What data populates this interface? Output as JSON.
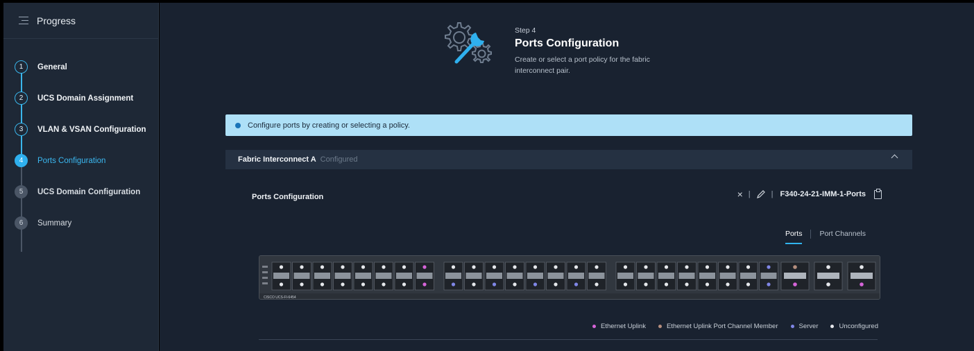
{
  "sidebar": {
    "title": "Progress",
    "steps": [
      {
        "num": "1",
        "label": "General"
      },
      {
        "num": "2",
        "label": "UCS Domain Assignment"
      },
      {
        "num": "3",
        "label": "VLAN & VSAN Configuration"
      },
      {
        "num": "4",
        "label": "Ports Configuration"
      },
      {
        "num": "5",
        "label": "UCS Domain Configuration"
      },
      {
        "num": "6",
        "label": "Summary"
      }
    ]
  },
  "header": {
    "step": "Step 4",
    "title": "Ports Configuration",
    "description": "Create or select a port policy for the fabric interconnect pair."
  },
  "info": {
    "text": "Configure ports by creating or selecting a policy."
  },
  "fabric": {
    "name": "Fabric Interconnect A",
    "status": "Configured"
  },
  "ports_config": {
    "title": "Ports Configuration",
    "clear_icon": "×",
    "divider": "|",
    "policy_name": "F340-24-21-IMM-1-Ports"
  },
  "tabs": {
    "ports": "Ports",
    "port_channels": "Port Channels"
  },
  "switch": {
    "model": "CISCO UCS-FI-6454"
  },
  "legend": [
    {
      "label": "Ethernet Uplink",
      "color": "#d664d8"
    },
    {
      "label": "Ethernet Uplink Port Channel Member",
      "color": "#b58e7e"
    },
    {
      "label": "Server",
      "color": "#7f86e6"
    },
    {
      "label": "Unconfigured",
      "color": "#e6e8ec"
    }
  ],
  "colors": {
    "accent": "#2fb0ee",
    "info_bg": "#aee0f7",
    "sidebar_bg": "#1e2836",
    "main_bg": "#192230"
  }
}
